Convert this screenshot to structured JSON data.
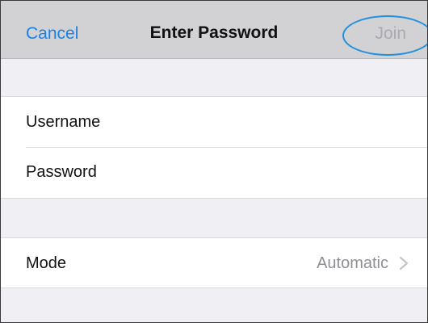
{
  "navbar": {
    "cancel_label": "Cancel",
    "title": "Enter Password",
    "join_label": "Join"
  },
  "credentials": {
    "username": {
      "label": "Username",
      "value": ""
    },
    "password": {
      "label": "Password",
      "value": ""
    }
  },
  "settings": {
    "mode": {
      "label": "Mode",
      "value": "Automatic",
      "icon": "chevron-right-icon"
    }
  },
  "colors": {
    "accent": "#1a82e6",
    "disabled": "#a9a9ae",
    "highlight": "#1f8fe0",
    "background": "#efeff4",
    "navbar": "#d2d2d5"
  }
}
